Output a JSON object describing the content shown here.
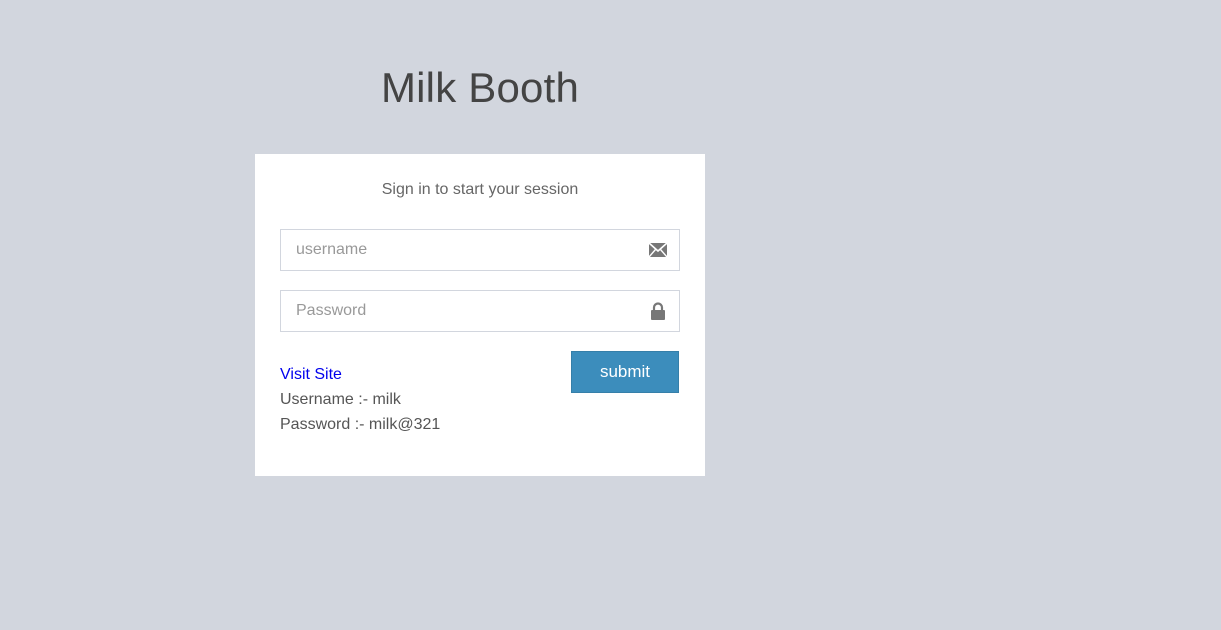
{
  "app": {
    "title": "Milk Booth"
  },
  "login": {
    "message": "Sign in to start your session",
    "username_placeholder": "username",
    "password_placeholder": "Password",
    "submit_label": "submit",
    "visit_site_label": "Visit Site",
    "username_hint": "Username :- milk",
    "password_hint": "Password :- milk@321"
  },
  "icons": {
    "username": "envelope-icon",
    "password": "lock-icon"
  },
  "colors": {
    "background": "#d2d6de",
    "primary_button": "#3c8dbc",
    "link": "#0000ee"
  }
}
